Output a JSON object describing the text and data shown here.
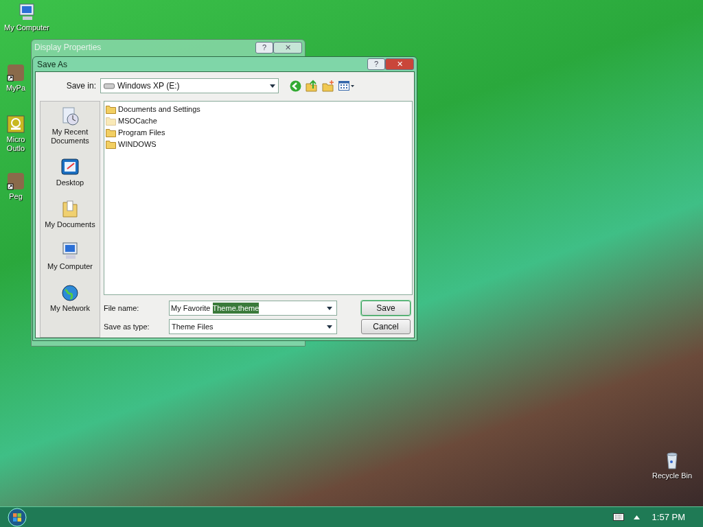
{
  "desktop_icons": [
    {
      "kind": "computer",
      "label": "My Computer"
    },
    {
      "kind": "shortcut",
      "label": "MyPa"
    },
    {
      "kind": "outlook",
      "label": "Micro Outlo"
    },
    {
      "kind": "shortcut",
      "label": "Peg"
    },
    {
      "kind": "bin",
      "label": "Recycle Bin"
    }
  ],
  "back_window": {
    "title": "Display Properties",
    "buttons": [
      "?",
      "✕"
    ]
  },
  "dialog": {
    "title": "Save As",
    "buttons": [
      "?",
      "✕"
    ],
    "save_in_label": "Save in:",
    "save_in": "Windows XP (E:)",
    "places": [
      {
        "kind": "recent",
        "label": "My Recent Documents"
      },
      {
        "kind": "desktop",
        "label": "Desktop"
      },
      {
        "kind": "documents",
        "label": "My Documents"
      },
      {
        "kind": "computer",
        "label": "My Computer"
      },
      {
        "kind": "network",
        "label": "My Network"
      }
    ],
    "files": [
      {
        "name": "Documents and Settings",
        "hidden": false
      },
      {
        "name": "MSOCache",
        "hidden": true
      },
      {
        "name": "Program Files",
        "hidden": false
      },
      {
        "name": "WINDOWS",
        "hidden": false
      }
    ],
    "file_name_label": "File name:",
    "file_name": {
      "value": "My Favorite ",
      "selection": "Theme.theme"
    },
    "type_label": "Save as type:",
    "type": "Theme Files",
    "actions": [
      {
        "label": "Save",
        "default": true
      },
      {
        "label": "Cancel",
        "default": false
      }
    ]
  },
  "taskbar": {
    "clock": "1:57 PM"
  }
}
